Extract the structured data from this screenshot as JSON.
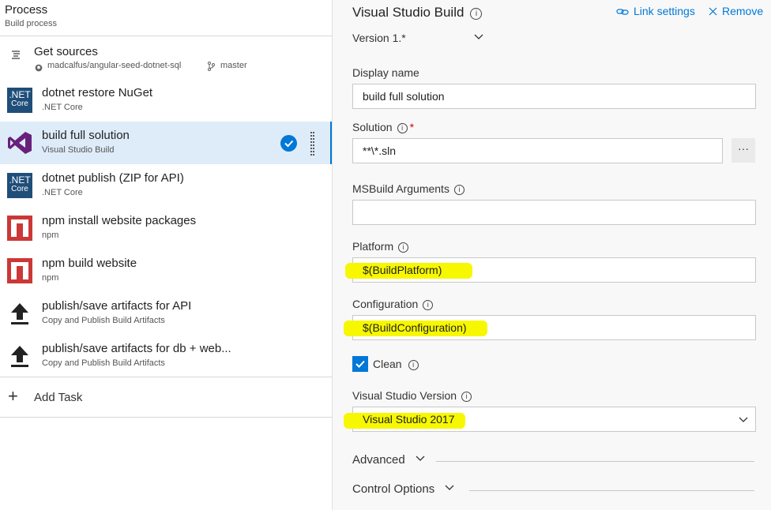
{
  "process": {
    "title": "Process",
    "subtitle": "Build process"
  },
  "sources": {
    "title": "Get sources",
    "repo": "madcalfus/angular-seed-dotnet-sql",
    "branch": "master"
  },
  "tasks": [
    {
      "name": "dotnet restore NuGet",
      "type": ".NET Core",
      "icon": "dotnet-core-icon"
    },
    {
      "name": "build full solution",
      "type": "Visual Studio Build",
      "icon": "visual-studio-icon"
    },
    {
      "name": "dotnet publish (ZIP for API)",
      "type": ".NET Core",
      "icon": "dotnet-core-icon"
    },
    {
      "name": "npm install website packages",
      "type": "npm",
      "icon": "npm-icon"
    },
    {
      "name": "npm build website",
      "type": "npm",
      "icon": "npm-icon"
    },
    {
      "name": "publish/save artifacts for API",
      "type": "Copy and Publish Build Artifacts",
      "icon": "upload-icon"
    },
    {
      "name": "publish/save artifacts for db + web...",
      "type": "Copy and Publish Build Artifacts",
      "icon": "upload-icon"
    }
  ],
  "net_icon": {
    "line1": ".NET",
    "line2": "Core"
  },
  "add_task": "Add Task",
  "detail": {
    "title": "Visual Studio Build",
    "link_settings": "Link settings",
    "remove": "Remove",
    "version": "Version  1.*",
    "display_name_label": "Display name",
    "display_name": "build full solution",
    "solution_label": "Solution",
    "solution": "**\\*.sln",
    "msbuild_label": "MSBuild Arguments",
    "msbuild": "",
    "platform_label": "Platform",
    "platform": "$(BuildPlatform)",
    "configuration_label": "Configuration",
    "configuration": "$(BuildConfiguration)",
    "clean_label": "Clean",
    "clean_checked": true,
    "vs_version_label": "Visual Studio Version",
    "vs_version": "Visual Studio 2017",
    "advanced": "Advanced",
    "control_options": "Control Options",
    "ellipsis": "···"
  },
  "colors": {
    "accent": "#0078d7",
    "selected_bg": "#deecf9",
    "highlight": "#f7f700",
    "npm_red": "#cb3837",
    "vs_purple": "#68217a"
  }
}
